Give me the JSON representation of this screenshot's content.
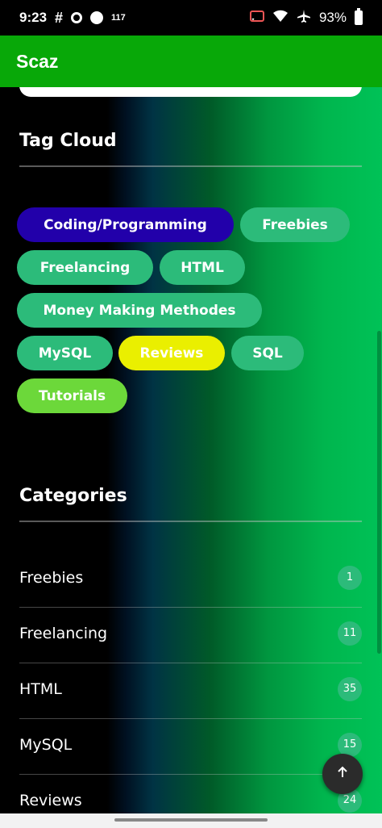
{
  "status_bar": {
    "time": "9:23",
    "notification_count": "117",
    "battery": "93%"
  },
  "app_bar": {
    "title": "Scaz"
  },
  "tag_cloud": {
    "title": "Tag Cloud",
    "tags": [
      {
        "label": "Coding/Programming",
        "color": "#2200aa"
      },
      {
        "label": "Freebies",
        "color": "#2cbb7a"
      },
      {
        "label": "Freelancing",
        "color": "#2cbb7a"
      },
      {
        "label": "HTML",
        "color": "#2cbb7a"
      },
      {
        "label": "Money Making Methodes",
        "color": "#2cbb7a"
      },
      {
        "label": "MySQL",
        "color": "#2cbb7a"
      },
      {
        "label": "Reviews",
        "color": "#eaef00"
      },
      {
        "label": "SQL",
        "color": "#2cbb7a"
      },
      {
        "label": "Tutorials",
        "color": "#6cd83a"
      }
    ]
  },
  "categories": {
    "title": "Categories",
    "items": [
      {
        "label": "Freebies",
        "count": "1"
      },
      {
        "label": "Freelancing",
        "count": "11"
      },
      {
        "label": "HTML",
        "count": "35"
      },
      {
        "label": "MySQL",
        "count": "15"
      },
      {
        "label": "Reviews",
        "count": "24"
      }
    ]
  },
  "scroll_top_icon": "arrow-up-icon"
}
